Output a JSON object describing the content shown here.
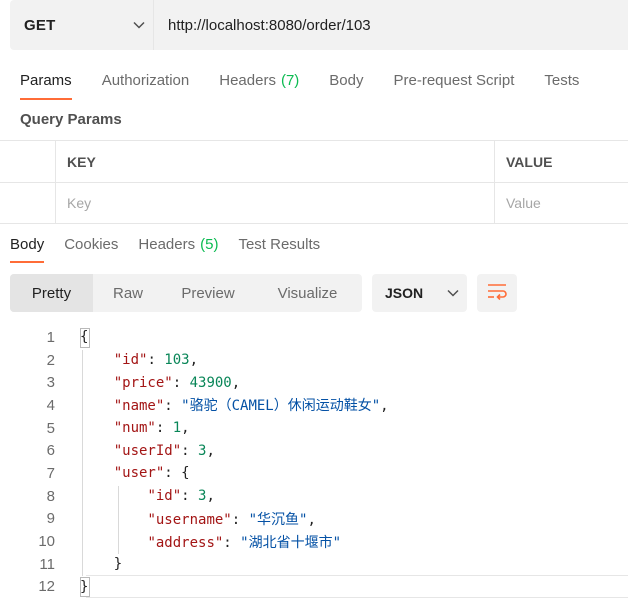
{
  "request": {
    "method": "GET",
    "url": "http://localhost:8080/order/103"
  },
  "request_tabs": [
    {
      "label": "Params",
      "count": "",
      "active": true
    },
    {
      "label": "Authorization",
      "count": ""
    },
    {
      "label": "Headers",
      "count": "(7)"
    },
    {
      "label": "Body",
      "count": ""
    },
    {
      "label": "Pre-request Script",
      "count": ""
    },
    {
      "label": "Tests",
      "count": ""
    }
  ],
  "query_params": {
    "title": "Query Params",
    "key_header": "KEY",
    "value_header": "VALUE",
    "key_placeholder": "Key",
    "value_placeholder": "Value"
  },
  "response_tabs": [
    {
      "label": "Body",
      "count": "",
      "active": true
    },
    {
      "label": "Cookies",
      "count": ""
    },
    {
      "label": "Headers",
      "count": "(5)"
    },
    {
      "label": "Test Results",
      "count": ""
    }
  ],
  "view_modes": [
    "Pretty",
    "Raw",
    "Preview",
    "Visualize"
  ],
  "active_view": "Pretty",
  "format": "JSON",
  "code_lines": [
    {
      "n": "1",
      "tokens": [
        [
          "p",
          "{"
        ]
      ]
    },
    {
      "n": "2",
      "tokens": [
        [
          "p",
          "    "
        ],
        [
          "k",
          "\"id\""
        ],
        [
          "p",
          ": "
        ],
        [
          "n",
          "103"
        ],
        [
          "p",
          ","
        ]
      ]
    },
    {
      "n": "3",
      "tokens": [
        [
          "p",
          "    "
        ],
        [
          "k",
          "\"price\""
        ],
        [
          "p",
          ": "
        ],
        [
          "n",
          "43900"
        ],
        [
          "p",
          ","
        ]
      ]
    },
    {
      "n": "4",
      "tokens": [
        [
          "p",
          "    "
        ],
        [
          "k",
          "\"name\""
        ],
        [
          "p",
          ": "
        ],
        [
          "s",
          "\"骆驼（CAMEL）休闲运动鞋女\""
        ],
        [
          "p",
          ","
        ]
      ]
    },
    {
      "n": "5",
      "tokens": [
        [
          "p",
          "    "
        ],
        [
          "k",
          "\"num\""
        ],
        [
          "p",
          ": "
        ],
        [
          "n",
          "1"
        ],
        [
          "p",
          ","
        ]
      ]
    },
    {
      "n": "6",
      "tokens": [
        [
          "p",
          "    "
        ],
        [
          "k",
          "\"userId\""
        ],
        [
          "p",
          ": "
        ],
        [
          "n",
          "3"
        ],
        [
          "p",
          ","
        ]
      ]
    },
    {
      "n": "7",
      "tokens": [
        [
          "p",
          "    "
        ],
        [
          "k",
          "\"user\""
        ],
        [
          "p",
          ": {"
        ]
      ]
    },
    {
      "n": "8",
      "tokens": [
        [
          "p",
          "        "
        ],
        [
          "k",
          "\"id\""
        ],
        [
          "p",
          ": "
        ],
        [
          "n",
          "3"
        ],
        [
          "p",
          ","
        ]
      ]
    },
    {
      "n": "9",
      "tokens": [
        [
          "p",
          "        "
        ],
        [
          "k",
          "\"username\""
        ],
        [
          "p",
          ": "
        ],
        [
          "s",
          "\"华沉鱼\""
        ],
        [
          "p",
          ","
        ]
      ]
    },
    {
      "n": "10",
      "tokens": [
        [
          "p",
          "        "
        ],
        [
          "k",
          "\"address\""
        ],
        [
          "p",
          ": "
        ],
        [
          "s",
          "\"湖北省十堰市\""
        ]
      ]
    },
    {
      "n": "11",
      "tokens": [
        [
          "p",
          "    }"
        ]
      ]
    },
    {
      "n": "12",
      "tokens": [
        [
          "p",
          "}"
        ]
      ]
    }
  ],
  "colors": {
    "accent": "#ff6c37",
    "count_green": "#0cbb52",
    "json_key": "#a31515",
    "json_string": "#0451a5",
    "json_number": "#098658"
  },
  "icons": {
    "method_dropdown": "chevron-down-icon",
    "format_dropdown": "chevron-down-icon",
    "wrap": "wrap-lines-icon"
  }
}
